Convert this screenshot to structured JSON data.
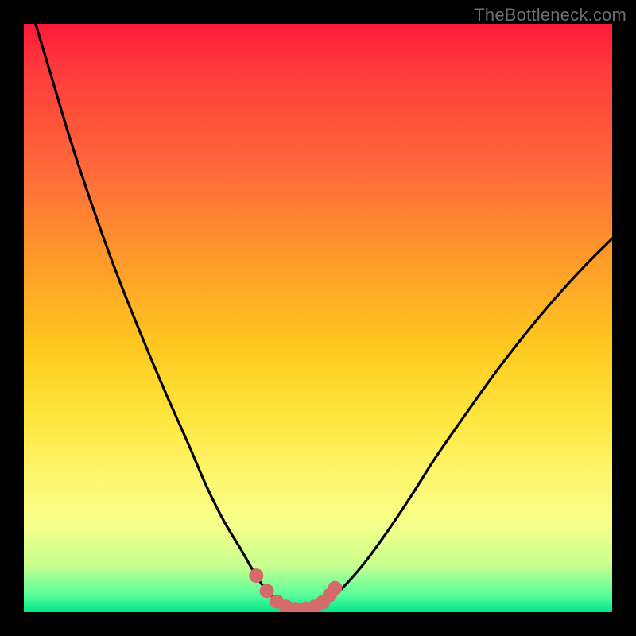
{
  "watermark": "TheBottleneck.com",
  "colors": {
    "frame": "#000000",
    "curve": "#000000",
    "marker_fill": "#d46a6a",
    "marker_stroke": "#c85a5a"
  },
  "chart_data": {
    "type": "line",
    "title": "",
    "xlabel": "",
    "ylabel": "",
    "xlim": [
      0,
      100
    ],
    "ylim": [
      0,
      100
    ],
    "grid": false,
    "legend": false,
    "note": "Values are read off the rendered curve as percentage of plot width (x) and height from bottom (y). The curve represents a bottleneck profile with a flat minimum around x≈44–50; highlighted markers trace the near-minimum segment.",
    "series": [
      {
        "name": "bottleneck-curve",
        "x": [
          0,
          2,
          5,
          8,
          12,
          16,
          20,
          24,
          28,
          31,
          34,
          37,
          39,
          41,
          43,
          45,
          47,
          49,
          51,
          53,
          55,
          58,
          62,
          66,
          70,
          75,
          80,
          85,
          90,
          95,
          100
        ],
        "y": [
          107,
          100,
          90,
          80,
          68,
          57,
          47,
          37.5,
          28.5,
          21.5,
          15.5,
          10.5,
          7,
          4,
          2,
          1,
          0.5,
          0.7,
          1.5,
          3,
          5,
          8.5,
          14,
          20,
          26.3,
          33.5,
          40.5,
          47,
          53,
          58.5,
          63.5
        ]
      }
    ],
    "markers": {
      "name": "near-optimum-dots",
      "x": [
        39.5,
        41.3,
        43.0,
        44.6,
        46.2,
        47.8,
        49.4,
        50.8,
        52.0,
        52.9
      ],
      "y": [
        6.2,
        3.6,
        1.8,
        0.9,
        0.5,
        0.55,
        0.9,
        1.7,
        2.9,
        4.1
      ]
    }
  }
}
